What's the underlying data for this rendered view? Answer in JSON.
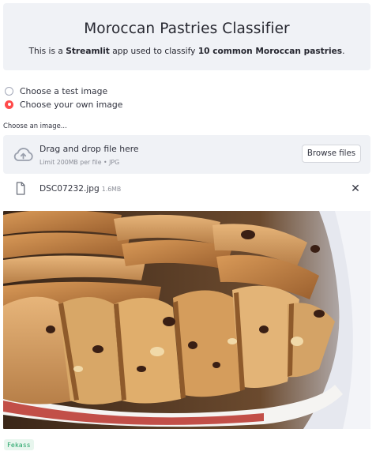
{
  "header": {
    "title": "Moroccan Pastries Classifier",
    "subtitle_prefix": "This is a ",
    "subtitle_app": "Streamlit",
    "subtitle_mid": " app used to classify ",
    "subtitle_bold": "10 common Moroccan pastries",
    "subtitle_suffix": "."
  },
  "radio_options": [
    {
      "label": "Choose a test image",
      "selected": false
    },
    {
      "label": "Choose your own image",
      "selected": true
    }
  ],
  "uploader": {
    "label": "Choose an image...",
    "drop_text": "Drag and drop file here",
    "limit_text": "Limit 200MB per file • JPG",
    "browse_label": "Browse files",
    "icon": "cloud-upload-icon"
  },
  "file": {
    "name": "DSC07232.jpg",
    "size": "1.6MB",
    "icon": "file-icon",
    "remove_icon": "close-icon"
  },
  "result": {
    "label": "Fekass"
  },
  "colors": {
    "accent": "#ff4b4b",
    "panel": "#f0f2f6",
    "success_bg": "#e8f6ee",
    "success_text": "#21a366"
  }
}
